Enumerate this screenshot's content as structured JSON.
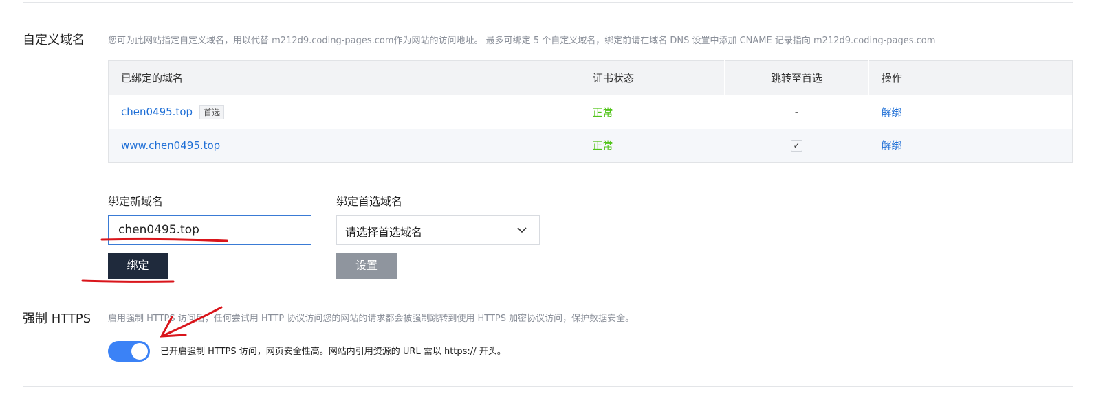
{
  "custom_domain": {
    "label": "自定义域名",
    "description": "您可为此网站指定自定义域名，用以代替 m212d9.coding-pages.com作为网站的访问地址。 最多可绑定 5 个自定义域名，绑定前请在域名 DNS 设置中添加 CNAME 记录指向 m212d9.coding-pages.com",
    "table": {
      "headers": [
        "已绑定的域名",
        "证书状态",
        "跳转至首选",
        "操作"
      ],
      "rows": [
        {
          "domain": "chen0495.top",
          "tag": "首选",
          "cert": "正常",
          "redirect": "-",
          "action": "解绑"
        },
        {
          "domain": "www.chen0495.top",
          "cert": "正常",
          "redirect": "✓",
          "action": "解绑"
        }
      ]
    },
    "bind_new": {
      "label": "绑定新域名",
      "value": "chen0495.top",
      "button": "绑定"
    },
    "preferred": {
      "label": "绑定首选域名",
      "placeholder": "请选择首选域名",
      "button": "设置"
    }
  },
  "https": {
    "label": "强制 HTTPS",
    "description": "启用强制 HTTPS 访问后，任何尝试用 HTTP 协议访问您的网站的请求都会被强制跳转到使用 HTTPS 加密协议访问，保护数据安全。",
    "enabled": true,
    "status": "已开启强制 HTTPS 访问，网页安全性高。网站内引用资源的 URL 需以 https:// 开头。"
  },
  "colors": {
    "accent": "#3b82f6",
    "link": "#1f6fd6",
    "ok": "#52c41a",
    "primary_button": "#1f2a3c",
    "disabled_button": "#8f959e",
    "annotation": "#d9151b"
  }
}
